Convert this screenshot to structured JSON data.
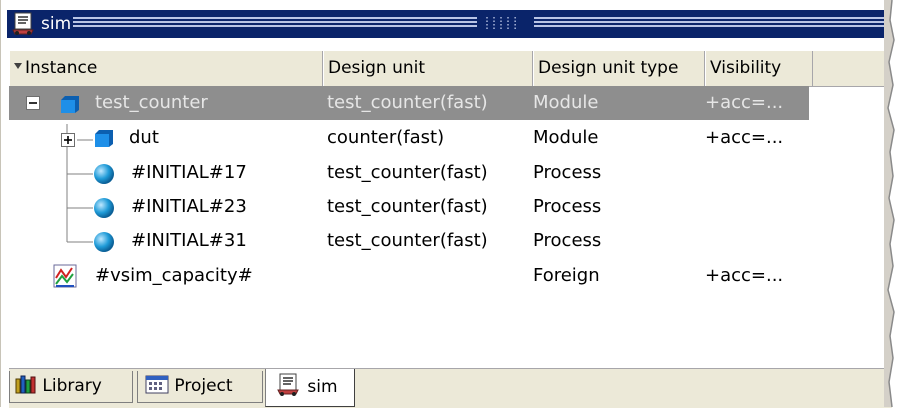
{
  "window": {
    "title": "sim",
    "title_icon": "sim-icon"
  },
  "columns": [
    "Instance",
    "Design unit",
    "Design unit type",
    "Visibility"
  ],
  "rows": [
    {
      "instance": "test_counter",
      "design_unit": "test_counter(fast)",
      "type": "Module",
      "visibility": "+acc=...",
      "icon": "module-icon",
      "expander": "collapse",
      "selected": true
    },
    {
      "instance": "dut",
      "design_unit": "counter(fast)",
      "type": "Module",
      "visibility": "+acc=...",
      "icon": "module-icon",
      "expander": "expand",
      "selected": false
    },
    {
      "instance": "#INITIAL#17",
      "design_unit": "test_counter(fast)",
      "type": "Process",
      "visibility": "",
      "icon": "process-icon"
    },
    {
      "instance": "#INITIAL#23",
      "design_unit": "test_counter(fast)",
      "type": "Process",
      "visibility": "",
      "icon": "process-icon"
    },
    {
      "instance": "#INITIAL#31",
      "design_unit": "test_counter(fast)",
      "type": "Process",
      "visibility": "",
      "icon": "process-icon"
    },
    {
      "instance": "#vsim_capacity#",
      "design_unit": "",
      "type": "Foreign",
      "visibility": "+acc=...",
      "icon": "foreign-icon"
    }
  ],
  "tabs": [
    {
      "label": "Library",
      "icon": "library-icon",
      "active": false
    },
    {
      "label": "Project",
      "icon": "project-icon",
      "active": false
    },
    {
      "label": "sim",
      "icon": "sim-icon",
      "active": true
    }
  ],
  "colors": {
    "titlebar": "#0a246a",
    "selection": "#8e8e8e",
    "chrome": "#ece9d8",
    "module_icon": "#1e8fe8",
    "process_icon": "#1f9bd8"
  }
}
